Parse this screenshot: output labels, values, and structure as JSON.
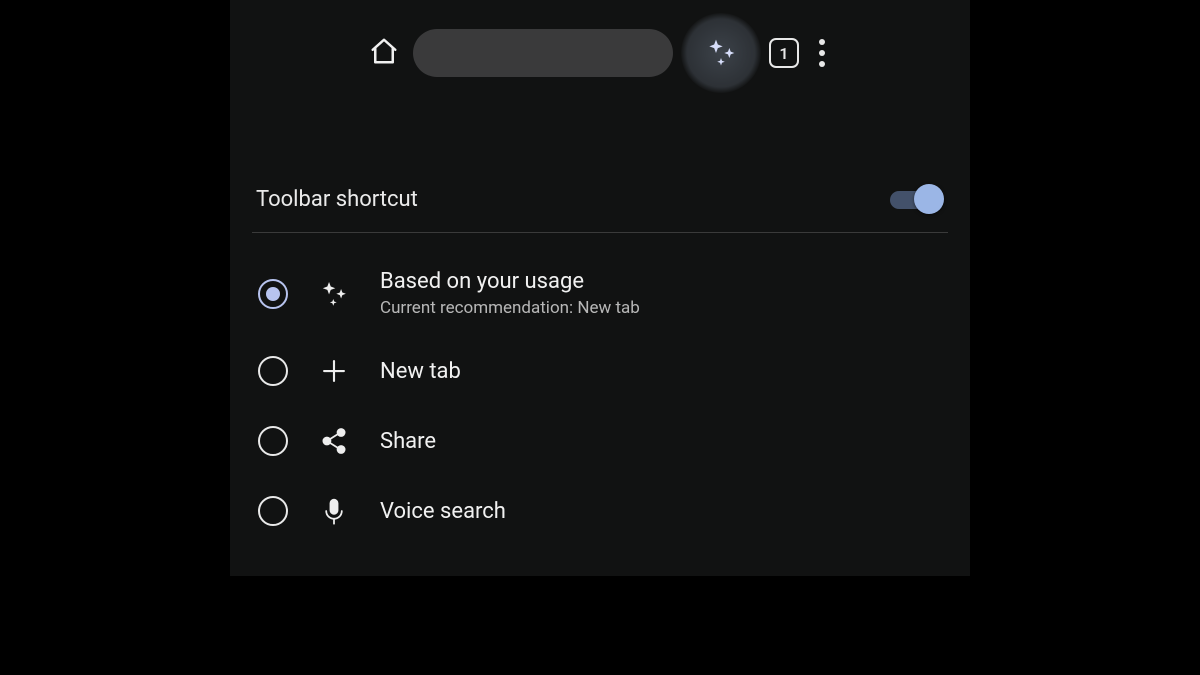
{
  "toolbar": {
    "tab_count": "1"
  },
  "settings": {
    "title": "Toolbar shortcut",
    "toggle_on": true
  },
  "options": {
    "items": [
      {
        "label": "Based on your usage",
        "sub": "Current recommendation:  New tab",
        "selected": true,
        "icon": "sparkle"
      },
      {
        "label": "New tab",
        "sub": "",
        "selected": false,
        "icon": "plus"
      },
      {
        "label": "Share",
        "sub": "",
        "selected": false,
        "icon": "share"
      },
      {
        "label": "Voice search",
        "sub": "",
        "selected": false,
        "icon": "mic"
      }
    ]
  }
}
